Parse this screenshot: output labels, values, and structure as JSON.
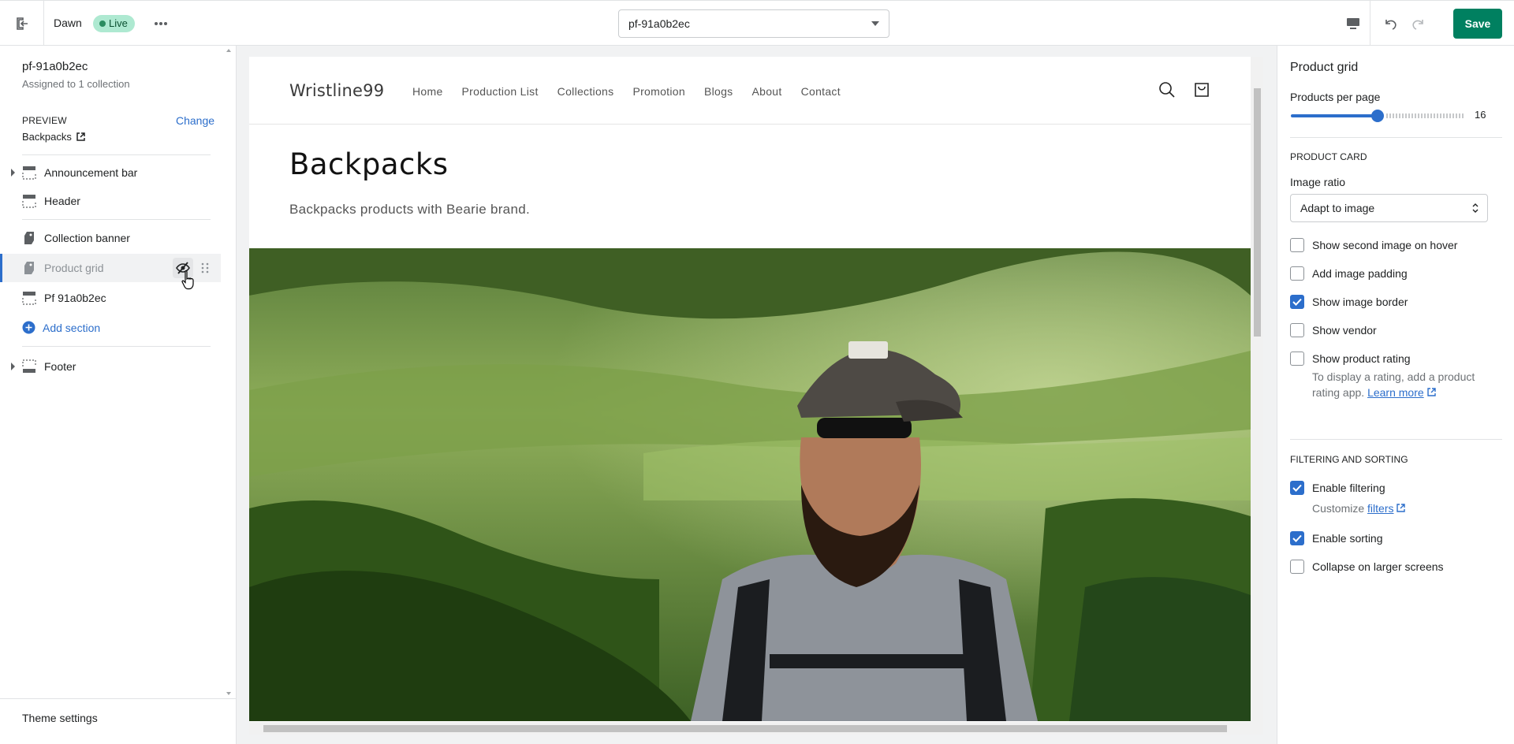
{
  "topbar": {
    "theme_name": "Dawn",
    "status_badge": "Live",
    "template_select": "pf-91a0b2ec",
    "save_label": "Save"
  },
  "sidebar": {
    "title": "pf-91a0b2ec",
    "subtitle": "Assigned to 1 collection",
    "preview_label": "PREVIEW",
    "preview_value": "Backpacks",
    "change_label": "Change",
    "sections": [
      {
        "label": "Announcement bar",
        "icon": "announcement-icon",
        "expandable": true
      },
      {
        "label": "Header",
        "icon": "header-icon",
        "expandable": false
      },
      {
        "label": "Collection banner",
        "icon": "banner-icon",
        "expandable": false
      },
      {
        "label": "Product grid",
        "icon": "product-grid-icon",
        "expandable": false,
        "selected": true,
        "hidden": true
      },
      {
        "label": "Pf 91a0b2ec",
        "icon": "section-icon",
        "expandable": false
      },
      {
        "label": "Footer",
        "icon": "footer-icon",
        "expandable": true
      }
    ],
    "add_section": "Add section",
    "theme_settings": "Theme settings"
  },
  "preview": {
    "logo": "Wristline99",
    "nav": [
      "Home",
      "Production List",
      "Collections",
      "Promotion",
      "Blogs",
      "About",
      "Contact"
    ],
    "collection_title": "Backpacks",
    "collection_description": "Backpacks products with Bearie brand."
  },
  "settings": {
    "title": "Product grid",
    "products_per_page_label": "Products per page",
    "products_per_page": 16,
    "products_per_page_fraction": 0.5,
    "product_card_heading": "PRODUCT CARD",
    "image_ratio_label": "Image ratio",
    "image_ratio_value": "Adapt to image",
    "options": {
      "second_image": {
        "label": "Show second image on hover",
        "checked": false
      },
      "image_padding": {
        "label": "Add image padding",
        "checked": false
      },
      "image_border": {
        "label": "Show image border",
        "checked": true
      },
      "vendor": {
        "label": "Show vendor",
        "checked": false
      },
      "rating": {
        "label": "Show product rating",
        "checked": false
      }
    },
    "rating_help": "To display a rating, add a product rating app.",
    "learn_more": "Learn more",
    "filtering_heading": "FILTERING AND SORTING",
    "filtering": {
      "label": "Enable filtering",
      "checked": true
    },
    "customize_prefix": "Customize",
    "filters_link": "filters",
    "sorting": {
      "label": "Enable sorting",
      "checked": true
    },
    "collapse": {
      "label": "Collapse on larger screens",
      "checked": false
    }
  },
  "colors": {
    "accent": "#2c6ecb",
    "save": "#008060",
    "live_badge": "#aee9d1"
  }
}
